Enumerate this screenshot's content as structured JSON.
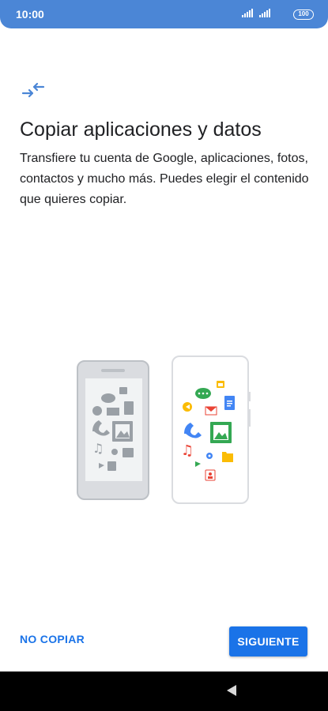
{
  "status_bar": {
    "time": "10:00",
    "battery": "100",
    "icons": [
      "signal-icon",
      "signal-icon",
      "battery-icon"
    ]
  },
  "header": {
    "icon": "transfer-arrows-icon",
    "title": "Copiar aplicaciones y datos",
    "description": "Transfiere tu cuenta de Google, aplicaciones, fotos, contactos y mucho más. Puedes elegir el contenido que quieres copiar."
  },
  "illustration": {
    "name": "phone-to-phone-transfer",
    "app_icons": [
      "chat-icon",
      "calendar-icon",
      "maps-icon",
      "gmail-icon",
      "docs-icon",
      "phone-icon",
      "photos-icon",
      "music-icon",
      "settings-icon",
      "folder-icon",
      "play-icon",
      "contacts-icon"
    ]
  },
  "actions": {
    "skip_label": "NO COPIAR",
    "next_label": "SIGUIENTE"
  },
  "nav_bar": {
    "icons": [
      "back-icon"
    ]
  },
  "colors": {
    "status_bar": "#4b86d6",
    "accent": "#1a73e8",
    "nav_bar": "#000000"
  }
}
